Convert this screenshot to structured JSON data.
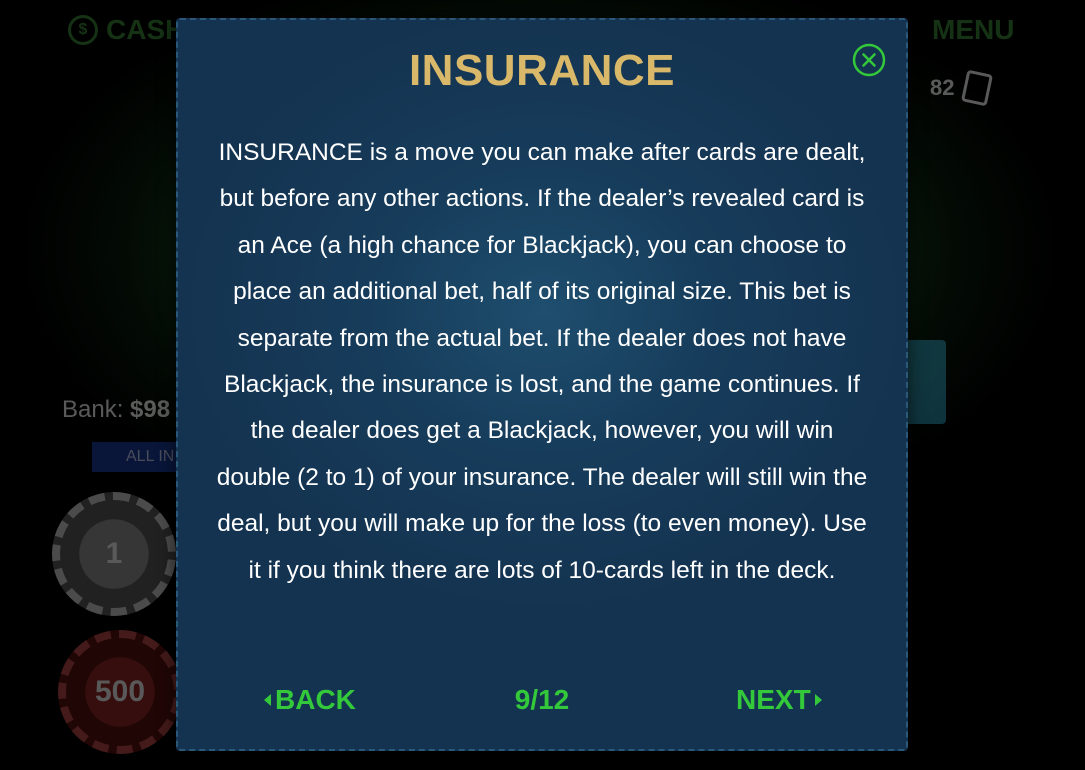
{
  "background": {
    "cashier_icon_label": "$",
    "cashier_label": "CASHIER",
    "menu_label": "MENU",
    "deck_count": "82",
    "bank_label": "Bank:",
    "bank_value": "$98",
    "all_in_label": "ALL IN",
    "chips": [
      {
        "value": "1"
      },
      {
        "value": "500"
      }
    ]
  },
  "modal": {
    "title": "INSURANCE",
    "body": "INSURANCE is a move you can make after cards are dealt, but before any other actions. If the dealer’s revealed card is an Ace (a high chance for Blackjack), you can choose to place an additional bet, half of its original size. This bet is separate from the actual bet. If the dealer does not have Blackjack, the insurance is lost, and the game continues. If the dealer does get a Blackjack, however, you will win double (2 to 1) of your insurance. The dealer will still win the deal, but you will make up for the loss (to even money). Use it if you think there are lots of 10-cards left in the deck.",
    "back_label": "BACK",
    "next_label": "NEXT",
    "page_indicator": "9/12"
  },
  "colors": {
    "title_gold": "#d9b86a",
    "nav_green": "#33c93a",
    "modal_bg": "#173d5c"
  }
}
